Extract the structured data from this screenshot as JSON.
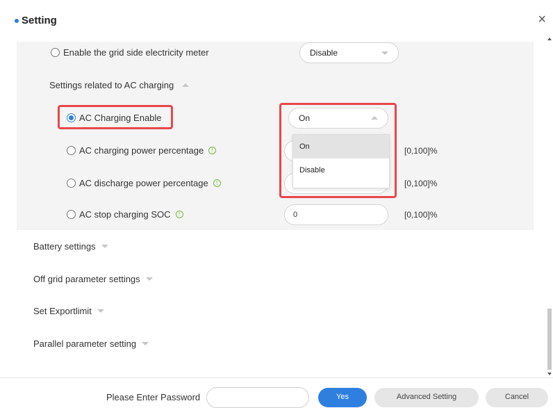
{
  "dialog": {
    "title": "Setting",
    "close_glyph": "×"
  },
  "grid_meter": {
    "label": "Enable the grid side electricity meter",
    "value": "Disable"
  },
  "ac_section": {
    "label": "Settings related to AC charging"
  },
  "ac_enable": {
    "label": "AC Charging Enable",
    "value": "On",
    "options": [
      "On",
      "Disable"
    ],
    "selected_option": "On"
  },
  "ac_charge_pct": {
    "label": "AC charging power percentage",
    "range": "[0,100]%"
  },
  "ac_discharge_pct": {
    "label": "AC discharge power percentage",
    "range": "[0,100]%"
  },
  "ac_stop_soc": {
    "label": "AC stop charging SOC",
    "value": "0",
    "range": "[0,100]%"
  },
  "sections": {
    "battery": "Battery settings",
    "off_grid": "Off grid parameter settings",
    "export": "Set Exportlimit",
    "parallel": "Parallel parameter setting"
  },
  "footer": {
    "password_label": "Please Enter Password",
    "yes": "Yes",
    "advanced": "Advanced Setting",
    "cancel": "Cancel"
  },
  "colors": {
    "accent": "#2f7fe0",
    "highlight_red": "#e8474b",
    "info_green": "#7ab83a"
  },
  "icons": {
    "info": "info-circle-icon",
    "close": "close-icon",
    "caret_up": "caret-up-icon",
    "caret_down": "caret-down-icon"
  }
}
